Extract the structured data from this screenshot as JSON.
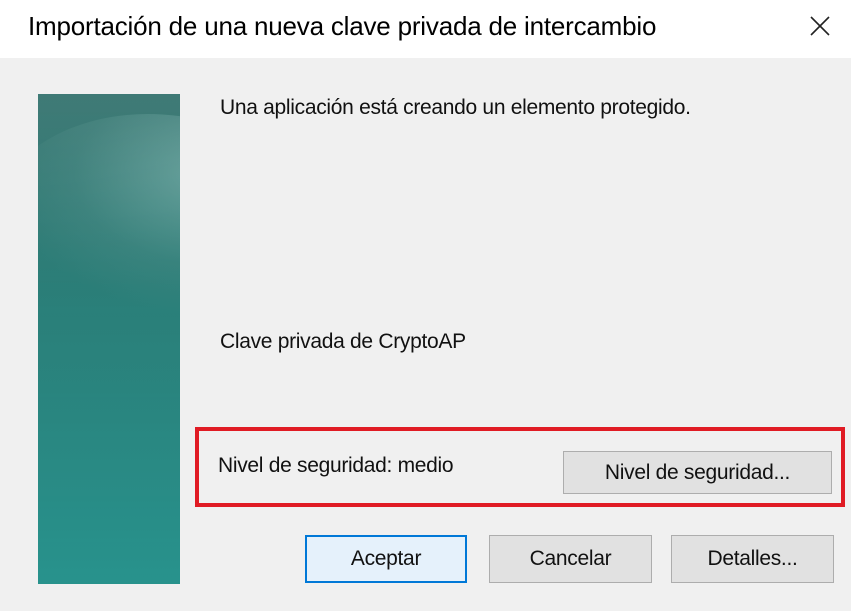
{
  "window": {
    "title": "Importación de una nueva clave privada de intercambio",
    "close_icon": "close-icon"
  },
  "content": {
    "message": "Una aplicación está creando un elemento protegido.",
    "key_name": "Clave privada de CryptoAP",
    "security_level_label": "Nivel de seguridad: medio",
    "security_level_button": "Nivel de seguridad..."
  },
  "buttons": {
    "ok": "Aceptar",
    "cancel": "Cancelar",
    "details": "Detalles..."
  },
  "colors": {
    "highlight": "#e01b24",
    "banner": "#2a8680",
    "default_button_border": "#0078d7"
  }
}
